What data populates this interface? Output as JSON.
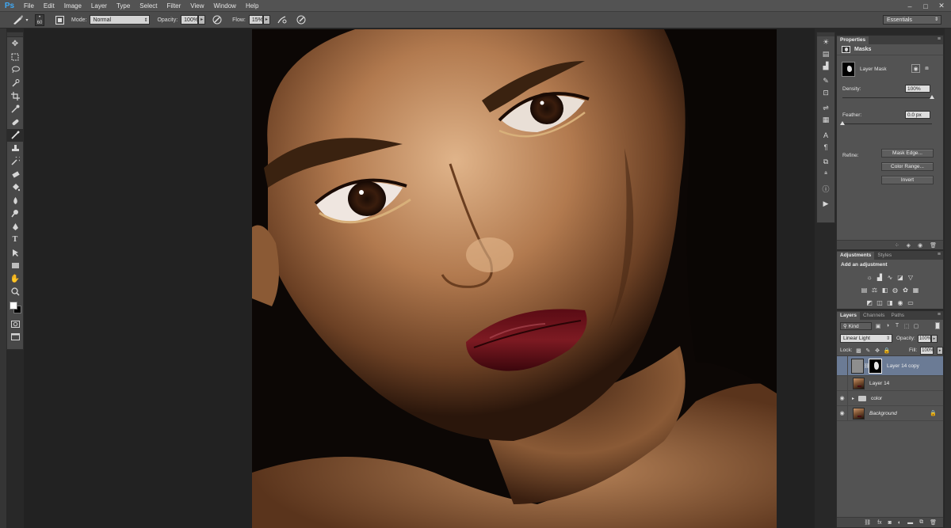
{
  "app": {
    "logo": "Ps"
  },
  "menu": [
    "File",
    "Edit",
    "Image",
    "Layer",
    "Type",
    "Select",
    "Filter",
    "View",
    "Window",
    "Help"
  ],
  "window_controls": {
    "minimize": "–",
    "maximize": "□",
    "close": "✕"
  },
  "options_bar": {
    "brush_size": "60",
    "mode_label": "Mode:",
    "mode_value": "Normal",
    "opacity_label": "Opacity:",
    "opacity_value": "100%",
    "flow_label": "Flow:",
    "flow_value": "15%",
    "workspace": "Essentials"
  },
  "tools": {
    "icons": [
      "move-icon",
      "marquee-icon",
      "lasso-icon",
      "quick-selection-icon",
      "crop-icon",
      "eyedropper-icon",
      "healing-brush-icon",
      "brush-icon",
      "clone-stamp-icon",
      "history-brush-icon",
      "eraser-icon",
      "paint-bucket-icon",
      "blur-icon",
      "dodge-icon",
      "pen-icon",
      "type-icon",
      "path-selection-icon",
      "rectangle-icon",
      "hand-icon",
      "zoom-icon"
    ],
    "active": "brush-icon",
    "foreground_color": "#ffffff",
    "background_color": "#000000"
  },
  "properties": {
    "tab": "Properties",
    "section": "Masks",
    "mask_label": "Layer Mask",
    "density_label": "Density:",
    "density_value": "100%",
    "density_level": 1.0,
    "feather_label": "Feather:",
    "feather_value": "0.0 px",
    "feather_level": 0.0,
    "refine_label": "Refine:",
    "buttons": [
      "Mask Edge...",
      "Color Range...",
      "Invert"
    ]
  },
  "adjustments": {
    "tabs": [
      "Adjustments",
      "Styles"
    ],
    "heading": "Add an adjustment"
  },
  "layers": {
    "tabs": [
      "Layers",
      "Channels",
      "Paths"
    ],
    "kind_label": "Kind",
    "blend_mode": "Linear Light",
    "opacity_label": "Opacity:",
    "opacity_value": "100%",
    "lock_label": "Lock:",
    "fill_label": "Fill:",
    "fill_value": "100%",
    "items": [
      {
        "name": "Layer 14 copy"
      },
      {
        "name": "Layer 14"
      },
      {
        "name": "color"
      },
      {
        "name": "Background"
      }
    ]
  }
}
